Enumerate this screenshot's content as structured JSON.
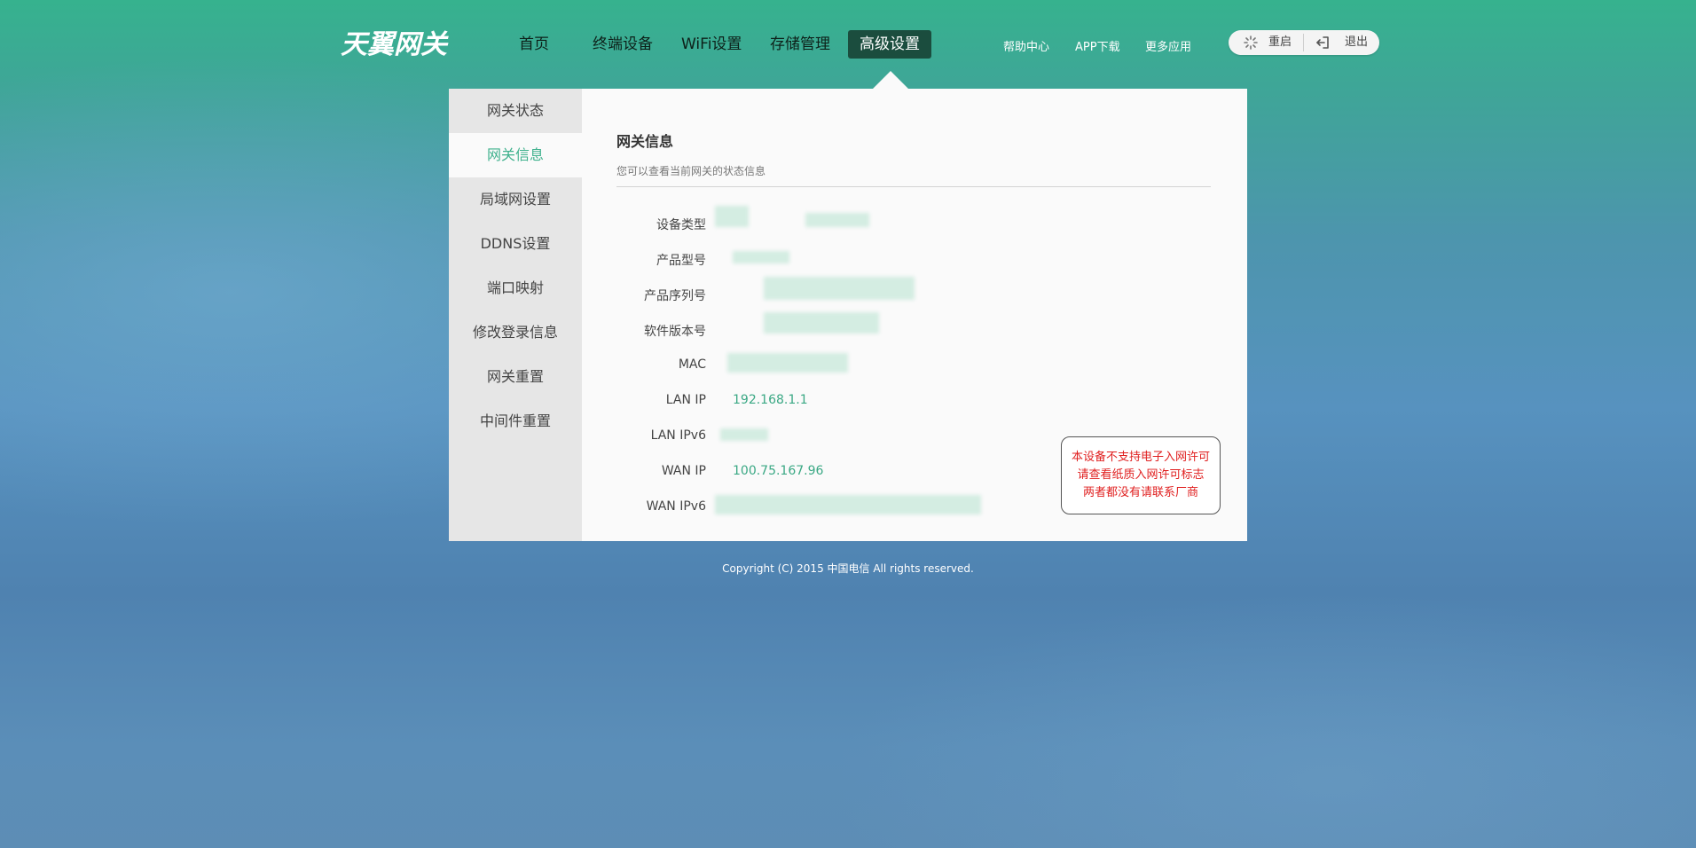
{
  "brand": {
    "logo_text": "天翼网关"
  },
  "nav": {
    "items": [
      {
        "label": "首页"
      },
      {
        "label": "终端设备"
      },
      {
        "label": "WiFi设置"
      },
      {
        "label": "存储管理"
      },
      {
        "label": "高级设置",
        "active": true
      }
    ]
  },
  "header_links": {
    "help": "帮助中心",
    "app": "APP下载",
    "more": "更多应用",
    "restart": "重启",
    "logout": "退出"
  },
  "sidebar": {
    "items": [
      {
        "label": "网关状态"
      },
      {
        "label": "网关信息",
        "active": true
      },
      {
        "label": "局域网设置"
      },
      {
        "label": "DDNS设置"
      },
      {
        "label": "端口映射"
      },
      {
        "label": "修改登录信息"
      },
      {
        "label": "网关重置"
      },
      {
        "label": "中间件重置"
      }
    ]
  },
  "content": {
    "title": "网关信息",
    "subtitle": "您可以查看当前网关的状态信息",
    "rows": [
      {
        "label": "设备类型",
        "value": ""
      },
      {
        "label": "产品型号",
        "value": ""
      },
      {
        "label": "产品序列号",
        "value": ""
      },
      {
        "label": "软件版本号",
        "value": ""
      },
      {
        "label": "MAC",
        "value": ""
      },
      {
        "label": "LAN IP",
        "value": "192.168.1.1"
      },
      {
        "label": "LAN IPv6",
        "value": ""
      },
      {
        "label": "WAN IP",
        "value": "100.75.167.96"
      },
      {
        "label": "WAN IPv6",
        "value": ""
      }
    ]
  },
  "notice": {
    "lines": [
      "本设备不支持电子入网许可",
      "请查看纸质入网许可标志",
      "两者都没有请联系厂商"
    ]
  },
  "footer": {
    "copyright": "Copyright (C) 2015 中国电信 All rights reserved."
  },
  "colors": {
    "accent": "#3fb18d",
    "nav_active_bg": "#1b4d3e",
    "notice_text": "#e02020"
  }
}
